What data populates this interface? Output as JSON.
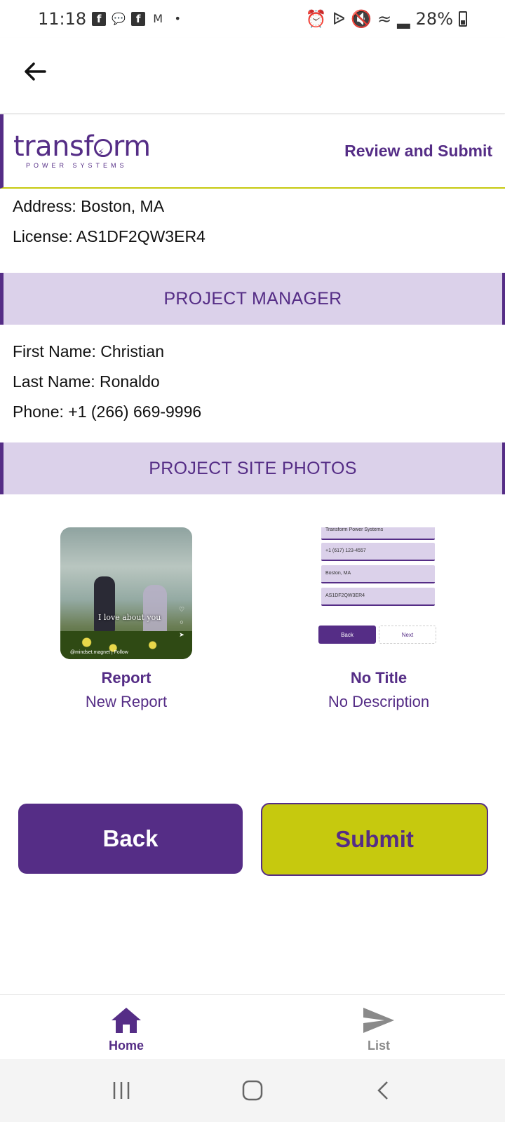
{
  "status_bar": {
    "time": "11:18",
    "battery": "28%"
  },
  "header": {
    "logo_word_left": "transf",
    "logo_word_right": "rm",
    "logo_subtitle": "POWER SYSTEMS",
    "title": "Review and Submit"
  },
  "company": {
    "address": "Address: Boston, MA",
    "license": "License: AS1DF2QW3ER4"
  },
  "project_manager": {
    "heading": "PROJECT MANAGER",
    "first_name": "First Name: Christian",
    "last_name": "Last Name: Ronaldo",
    "phone": "Phone: +1 (266) 669-9996"
  },
  "photos": {
    "heading": "PROJECT SITE PHOTOS",
    "items": [
      {
        "title": "Report",
        "description": "New Report",
        "thumb_caption": "I love about you",
        "thumb_handle": "@mindset.magnet | Follow"
      },
      {
        "title": "No Title",
        "description": "No Description",
        "thumb_fields": [
          "Transform Power Systems",
          "+1 (617) 123-4557",
          "Boston, MA",
          "AS1DF2QW3ER4"
        ],
        "thumb_back": "Back",
        "thumb_next": "Next"
      }
    ]
  },
  "actions": {
    "back_label": "Back",
    "submit_label": "Submit"
  },
  "bottom_nav": {
    "home_label": "Home",
    "list_label": "List"
  },
  "colors": {
    "brand_purple": "#552d86",
    "accent_lime": "#c6c90e",
    "section_bg": "#dbd1ea"
  }
}
